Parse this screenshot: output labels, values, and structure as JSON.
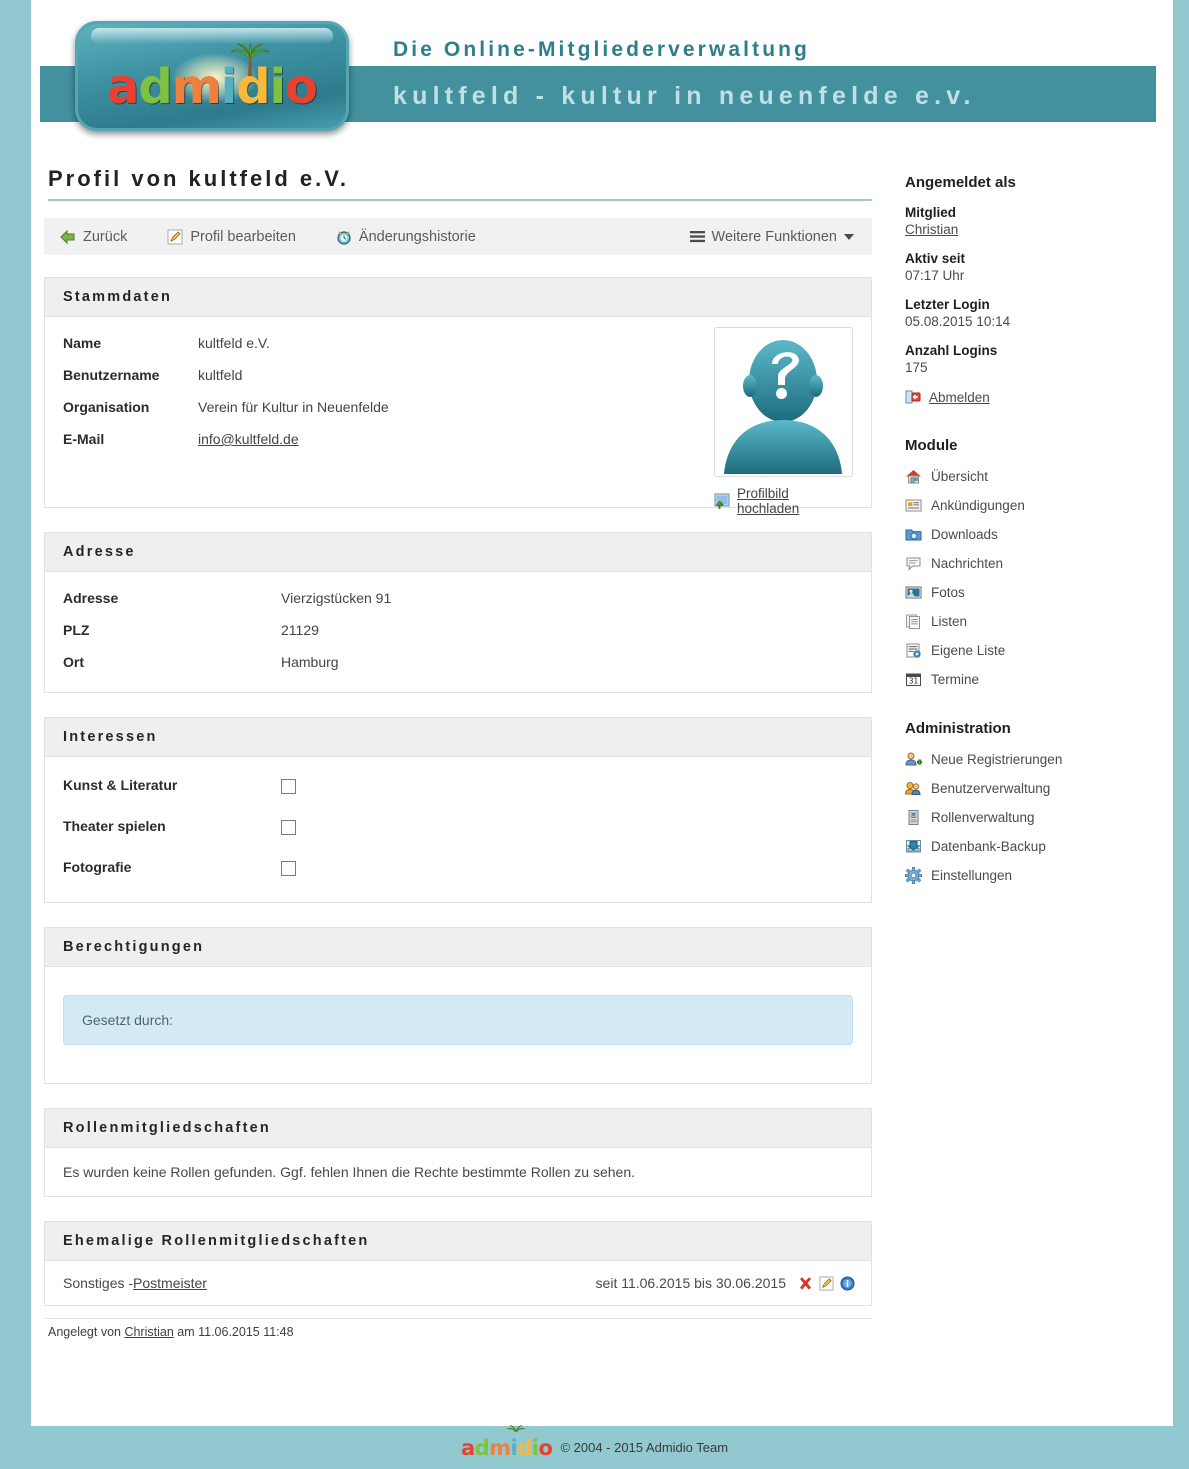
{
  "brand": {
    "logo_text": "admidio",
    "slogan": "Die Online-Mitgliederverwaltung",
    "organization": "kultfeld - kultur in neuenfelde e.v."
  },
  "page": {
    "title": "Profil von kultfeld e.V."
  },
  "toolbar": {
    "back": "Zurück",
    "edit_profile": "Profil bearbeiten",
    "history": "Änderungshistorie",
    "more_functions": "Weitere Funktionen"
  },
  "stammdaten": {
    "heading": "Stammdaten",
    "fields": [
      {
        "label": "Name",
        "value": "kultfeld e.V."
      },
      {
        "label": "Benutzername",
        "value": "kultfeld"
      },
      {
        "label": "Organisation",
        "value": "Verein für Kultur in Neuenfelde"
      },
      {
        "label": "E-Mail",
        "value": "info@kultfeld.de"
      }
    ],
    "upload_label": "Profilbild hochladen"
  },
  "adresse": {
    "heading": "Adresse",
    "fields": [
      {
        "label": "Adresse",
        "value": "Vierzigstücken 91"
      },
      {
        "label": "PLZ",
        "value": "21129"
      },
      {
        "label": "Ort",
        "value": "Hamburg"
      }
    ]
  },
  "interessen": {
    "heading": "Interessen",
    "items": [
      {
        "label": "Kunst & Literatur",
        "checked": false
      },
      {
        "label": "Theater spielen",
        "checked": false
      },
      {
        "label": "Fotografie",
        "checked": false
      }
    ]
  },
  "berechtigungen": {
    "heading": "Berechtigungen",
    "info": "Gesetzt durch:"
  },
  "rollen": {
    "heading": "Rollenmitgliedschaften",
    "empty_text": "Es wurden keine Rollen gefunden. Ggf. fehlen Ihnen die Rechte bestimmte Rollen zu sehen."
  },
  "ehemalige_rollen": {
    "heading": "Ehemalige Rollenmitgliedschaften",
    "rows": [
      {
        "category": "Sonstiges - ",
        "role": "Postmeister",
        "period": "seit 11.06.2015 bis 30.06.2015"
      }
    ]
  },
  "created": {
    "prefix": "Angelegt von ",
    "user": "Christian",
    "suffix": " am 11.06.2015 11:48"
  },
  "sidebar": {
    "logged_in_heading": "Angemeldet als",
    "member_label": "Mitglied",
    "member_name": "Christian",
    "active_label": "Aktiv seit",
    "active_value": "07:17 Uhr",
    "last_login_label": "Letzter Login",
    "last_login_value": "05.08.2015 10:14",
    "login_count_label": "Anzahl Logins",
    "login_count_value": "175",
    "logout_label": "Abmelden",
    "modules_heading": "Module",
    "modules": [
      {
        "label": "Übersicht",
        "icon": "home-icon"
      },
      {
        "label": "Ankündigungen",
        "icon": "announcement-icon"
      },
      {
        "label": "Downloads",
        "icon": "download-folder-icon"
      },
      {
        "label": "Nachrichten",
        "icon": "message-icon"
      },
      {
        "label": "Fotos",
        "icon": "photo-icon"
      },
      {
        "label": "Listen",
        "icon": "list-icon"
      },
      {
        "label": "Eigene Liste",
        "icon": "custom-list-icon"
      },
      {
        "label": "Termine",
        "icon": "calendar-icon"
      }
    ],
    "admin_heading": "Administration",
    "admin": [
      {
        "label": "Neue Registrierungen",
        "icon": "user-add-icon"
      },
      {
        "label": "Benutzerverwaltung",
        "icon": "users-icon"
      },
      {
        "label": "Rollenverwaltung",
        "icon": "roles-icon"
      },
      {
        "label": "Datenbank-Backup",
        "icon": "database-backup-icon"
      },
      {
        "label": "Einstellungen",
        "icon": "gear-icon"
      }
    ]
  },
  "footer": {
    "logo_text": "admidio",
    "copyright": "© 2004 - 2015  Admidio Team"
  },
  "colors": {
    "page_bg": "#92c8d0",
    "banner": "#43919e",
    "slogan": "#2f7e8b",
    "org_text": "#bfe0e4",
    "panel_head": "#efefef",
    "info_box": "#d3eaf4",
    "title_underline": "#9cc9d2"
  }
}
